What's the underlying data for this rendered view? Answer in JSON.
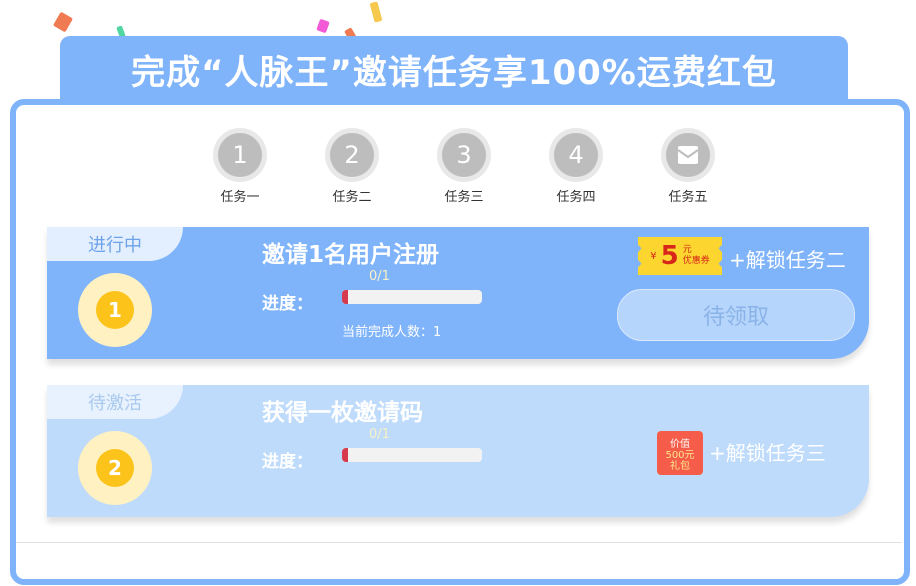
{
  "banner": {
    "title": "完成“人脉王”邀请任务享100%运费红包"
  },
  "steps": [
    {
      "number": "1",
      "label": "任务一"
    },
    {
      "number": "2",
      "label": "任务二"
    },
    {
      "number": "3",
      "label": "任务三"
    },
    {
      "number": "4",
      "label": "任务四"
    },
    {
      "label": "任务五",
      "icon": "gift-envelope-icon"
    }
  ],
  "tasks": [
    {
      "status": "进行中",
      "number": "1",
      "title": "邀请1名用户注册",
      "progress_label": "进度：",
      "progress_count": "0/1",
      "progress_fraction": 0,
      "current_completed": "当前完成人数：1",
      "reward_coupon": {
        "currency": "¥",
        "amount": "5",
        "unit": "元",
        "label": "优惠券"
      },
      "reward_text": "+解锁任务二",
      "claim_button": "待领取"
    },
    {
      "status": "待激活",
      "number": "2",
      "title": "获得一枚邀请码",
      "progress_label": "进度：",
      "progress_count": "0/1",
      "progress_fraction": 0,
      "reward_gift": {
        "line1": "价值",
        "line2": "500元",
        "line3": "礼包"
      },
      "reward_text": "+解锁任务三"
    }
  ],
  "colors": {
    "primary": "#7fb4fb",
    "light": "#bfdbfb",
    "accent_red": "#d73a4c",
    "coin": "#fcc31a"
  }
}
